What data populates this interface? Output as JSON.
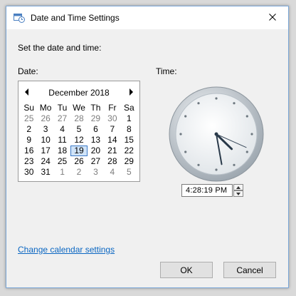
{
  "window": {
    "title": "Date and Time Settings"
  },
  "heading": "Set the date and time:",
  "date_label": "Date:",
  "time_label": "Time:",
  "calendar": {
    "month_label": "December 2018",
    "weekdays": [
      "Su",
      "Mo",
      "Tu",
      "We",
      "Th",
      "Fr",
      "Sa"
    ],
    "weeks": [
      [
        "25",
        "26",
        "27",
        "28",
        "29",
        "30",
        "1"
      ],
      [
        "2",
        "3",
        "4",
        "5",
        "6",
        "7",
        "8"
      ],
      [
        "9",
        "10",
        "11",
        "12",
        "13",
        "14",
        "15"
      ],
      [
        "16",
        "17",
        "18",
        "19",
        "20",
        "21",
        "22"
      ],
      [
        "23",
        "24",
        "25",
        "26",
        "27",
        "28",
        "29"
      ],
      [
        "30",
        "31",
        "1",
        "2",
        "3",
        "4",
        "5"
      ]
    ],
    "selected_day": "19"
  },
  "time": {
    "value": "4:28:19 PM",
    "hour": 4,
    "minute": 28,
    "second": 19
  },
  "change_calendar_link": "Change calendar settings",
  "buttons": {
    "ok": "OK",
    "cancel": "Cancel"
  }
}
